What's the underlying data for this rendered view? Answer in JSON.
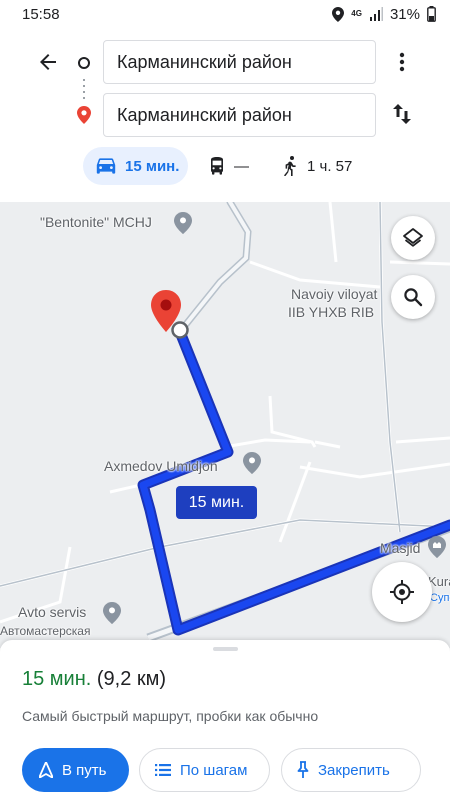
{
  "status_bar": {
    "time": "15:58",
    "network": "4G",
    "battery": "31%"
  },
  "directions": {
    "origin": "Карманинский район",
    "destination": "Карманинский район",
    "modes": {
      "drive": "15 мин.",
      "transit": "—",
      "walk": "1 ч. 57"
    }
  },
  "map": {
    "labels": {
      "bentonite": "\"Bentonite\" MCHJ",
      "navoiy_line1": "Navoiy viloyat",
      "navoiy_line2": "IIB YHXB RIB",
      "axmedov": "Axmedov Umidjon",
      "masjid": "Masjid",
      "avto": "Avto servis",
      "avto_sub": "Автомастерская",
      "kura": "Kura",
      "supe": "Супе"
    },
    "route_duration": "15 мин.",
    "colors": {
      "route": "#1a47f0",
      "route_chip": "#1e3fbf",
      "destination_pin": "#ea4335"
    }
  },
  "sheet": {
    "time": "15 мин.",
    "distance": "(9,2 км)",
    "description": "Самый быстрый маршрут, пробки как обычно",
    "buttons": {
      "go": "В путь",
      "steps": "По шагам",
      "pin": "Закрепить"
    }
  }
}
